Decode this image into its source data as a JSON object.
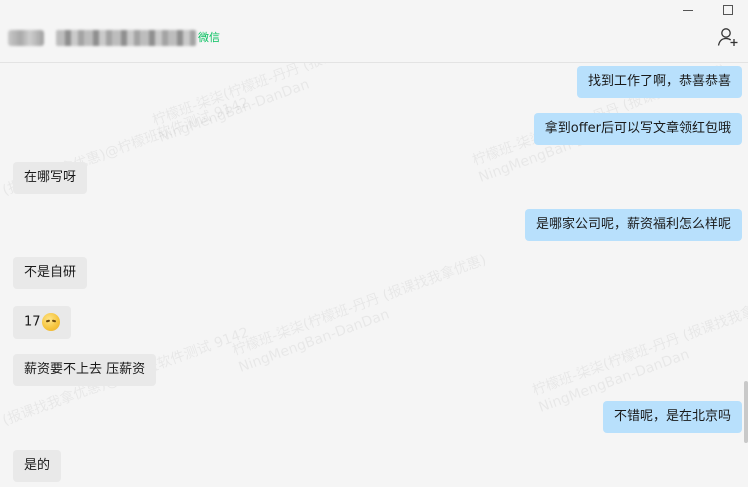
{
  "header": {
    "tag": "微信"
  },
  "watermark": {
    "line1": "柠檬班-柒柒(柠檬班-丹丹 (报课找我拿优惠)",
    "line2": "NingMengBan-DanDan",
    "line3": "(报课找我拿优惠)@柠檬班软件测试 9142"
  },
  "messages": [
    {
      "dir": "out",
      "text": "找到工作了啊，恭喜恭喜"
    },
    {
      "dir": "out",
      "text": "拿到offer后可以写文章领红包哦"
    },
    {
      "dir": "in",
      "text": "在哪写呀"
    },
    {
      "dir": "out",
      "text": "是哪家公司呢，薪资福利怎么样呢"
    },
    {
      "dir": "in",
      "text": "不是自研"
    },
    {
      "dir": "in",
      "text": "17",
      "emoji": "grinning-face-with-sweat-emoji"
    },
    {
      "dir": "in",
      "text": "薪资要不上去 压薪资"
    },
    {
      "dir": "out",
      "text": "不错呢，是在北京吗"
    },
    {
      "dir": "in",
      "text": "是的"
    }
  ],
  "icons": {
    "minimize": "minimize-icon",
    "maximize": "maximize-icon",
    "add_member": "add-person-icon"
  },
  "colors": {
    "outgoing_bubble": "#b8e0fc",
    "incoming_bubble": "#e9e9e9",
    "wechat_tag": "#07c160",
    "background": "#f5f5f5"
  }
}
